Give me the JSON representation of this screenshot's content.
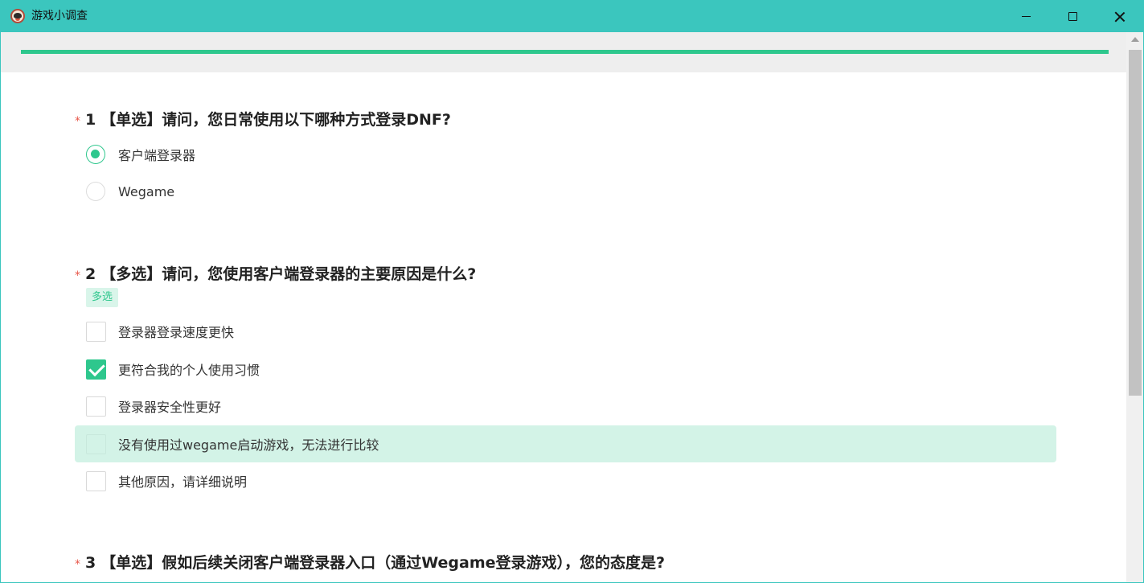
{
  "window": {
    "title": "游戏小调查"
  },
  "progress": {
    "percent": 100
  },
  "colors": {
    "accent": "#2ec78d",
    "titlebar": "#3bc6be",
    "required": "#e8574a"
  },
  "questions": [
    {
      "star": "*",
      "number": "1",
      "title": "【单选】请问，您日常使用以下哪种方式登录DNF?",
      "type": "radio",
      "options": [
        {
          "label": "客户端登录器",
          "checked": true
        },
        {
          "label": "Wegame",
          "checked": false
        }
      ]
    },
    {
      "star": "*",
      "number": "2",
      "title": "【多选】请问，您使用客户端登录器的主要原因是什么?",
      "type": "checkbox",
      "tag": "多选",
      "options": [
        {
          "label": "登录器登录速度更快",
          "checked": false
        },
        {
          "label": "更符合我的个人使用习惯",
          "checked": true
        },
        {
          "label": "登录器安全性更好",
          "checked": false
        },
        {
          "label": "没有使用过wegame启动游戏，无法进行比较",
          "checked": false,
          "hovered": true
        },
        {
          "label": "其他原因，请详细说明",
          "checked": false
        }
      ]
    },
    {
      "star": "*",
      "number": "3",
      "title": "【单选】假如后续关闭客户端登录器入口（通过Wegame登录游戏），您的态度是?",
      "type": "radio",
      "options": []
    }
  ]
}
